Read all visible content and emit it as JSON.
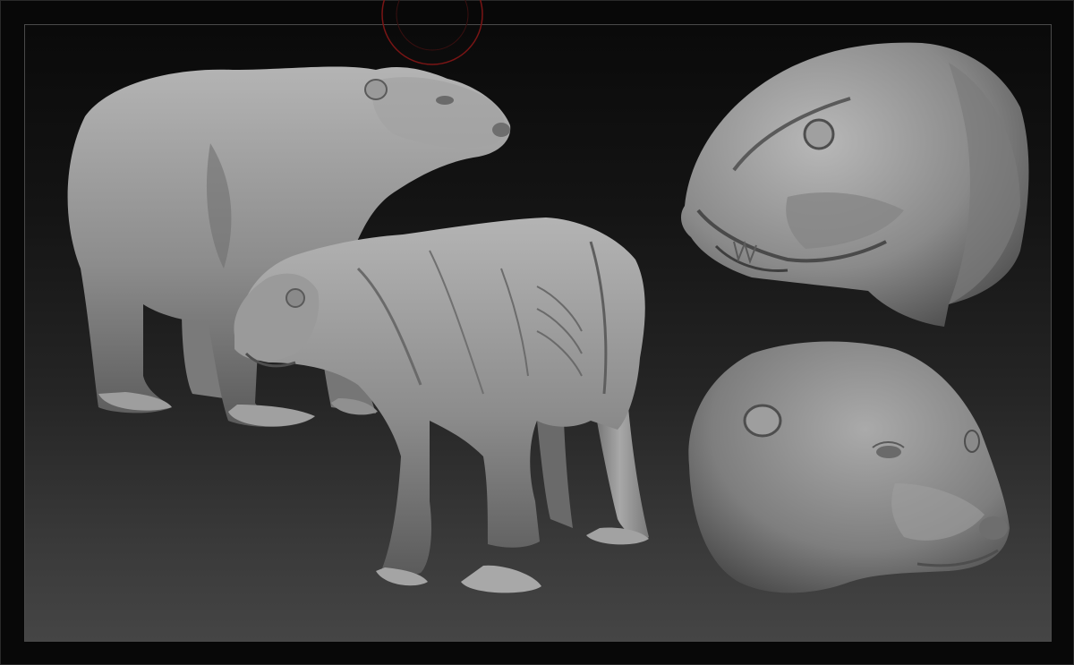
{
  "canvas": {
    "background_top": "#0a0a0a",
    "background_bottom": "#454545",
    "frame_border": "#4a4a4a"
  },
  "models": [
    {
      "label": "full-body-bear-model"
    },
    {
      "label": "muscle-anatomy-bear-model"
    },
    {
      "label": "head-anatomy-skull-model"
    },
    {
      "label": "head-skin-model"
    }
  ],
  "colors": {
    "clay": "#8e8e8e",
    "clay_light": "#b6b6b6",
    "clay_dark": "#4a4a4a",
    "gizmo": "#8a1a1a"
  }
}
